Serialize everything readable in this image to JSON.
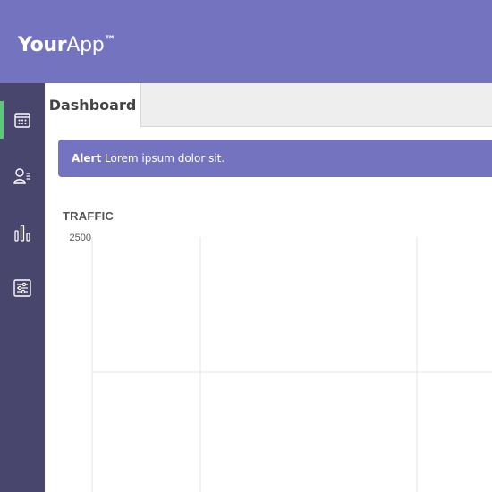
{
  "header": {
    "brand_bold": "Your",
    "brand_regular": "App",
    "brand_tm": "™"
  },
  "sidebar": {
    "items": [
      {
        "icon": "calendar-icon",
        "active": true
      },
      {
        "icon": "users-list-icon",
        "active": false
      },
      {
        "icon": "bar-chart-icon",
        "active": false
      },
      {
        "icon": "sliders-icon",
        "active": false
      }
    ],
    "active_color": "#5cc97a"
  },
  "tabs": {
    "active_label": "Dashboard"
  },
  "alert": {
    "label": "Alert",
    "message": "Lorem ipsum dolor sit."
  },
  "chart": {
    "title": "TRAFFIC"
  },
  "chart_data": {
    "type": "line",
    "title": "TRAFFIC",
    "y_tick_labels": [
      "2500"
    ],
    "grid": true,
    "series": []
  },
  "colors": {
    "header": "#7473c0",
    "sidebar": "#48466d",
    "alert": "#7473c0",
    "tab_strip": "#eeeeee",
    "grid": "#e6e6e6"
  }
}
